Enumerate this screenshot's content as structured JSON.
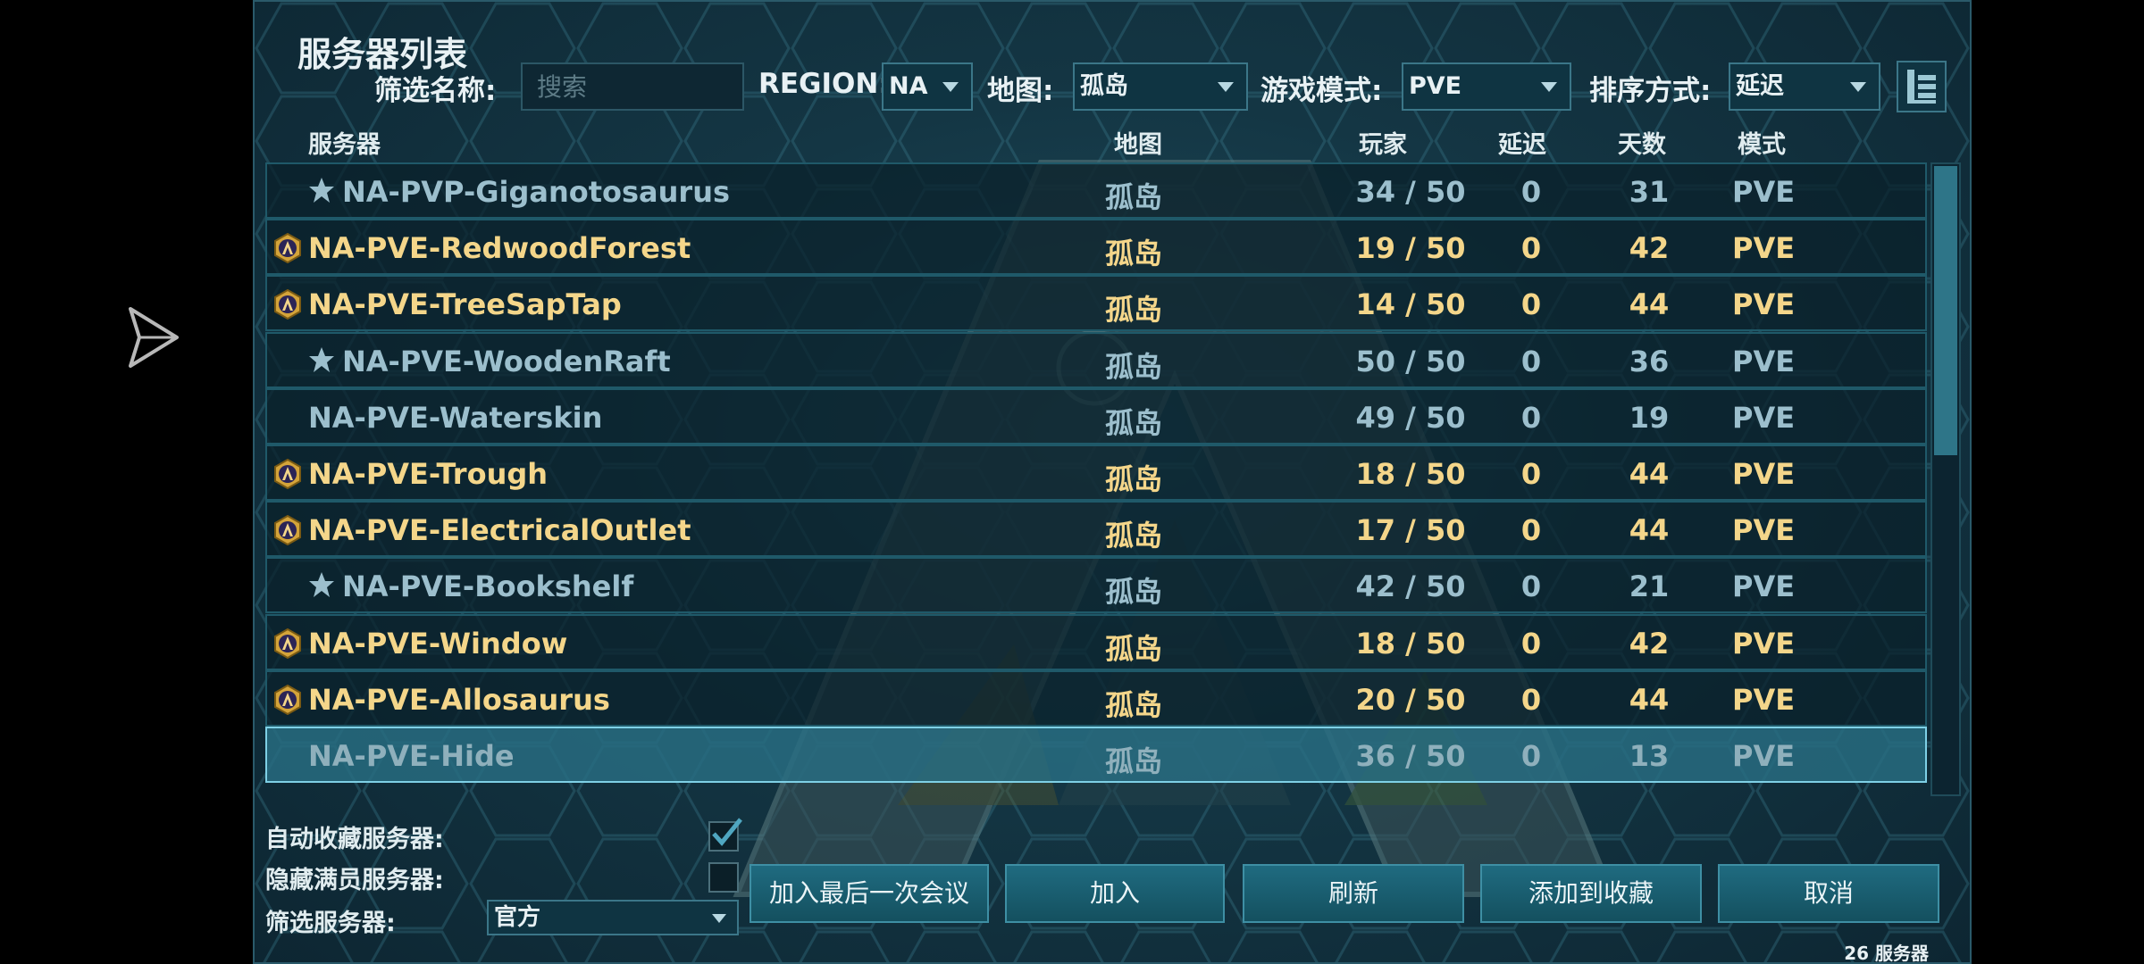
{
  "title": "服务器列表",
  "filters": {
    "name_label": "筛选名称:",
    "search_placeholder": "搜索",
    "region_label": "REGION:",
    "region_value": "NA",
    "map_label": "地图:",
    "map_value": "孤岛",
    "mode_label": "游戏模式:",
    "mode_value": "PVE",
    "sort_label": "排序方式:",
    "sort_value": "延迟"
  },
  "columns": {
    "server": "服务器",
    "map": "地图",
    "players": "玩家",
    "ping": "延迟",
    "days": "天数",
    "mode": "模式"
  },
  "servers": [
    {
      "name": "NA-PVP-Giganotosaurus",
      "map": "孤岛",
      "players": "34 / 50",
      "ping": "0",
      "days": "31",
      "mode": "PVE",
      "style": "favorite",
      "selected": false
    },
    {
      "name": "NA-PVE-RedwoodForest",
      "map": "孤岛",
      "players": "19 / 50",
      "ping": "0",
      "days": "42",
      "mode": "PVE",
      "style": "official",
      "selected": false
    },
    {
      "name": "NA-PVE-TreeSapTap",
      "map": "孤岛",
      "players": "14 / 50",
      "ping": "0",
      "days": "44",
      "mode": "PVE",
      "style": "official",
      "selected": false
    },
    {
      "name": "NA-PVE-WoodenRaft",
      "map": "孤岛",
      "players": "50 / 50",
      "ping": "0",
      "days": "36",
      "mode": "PVE",
      "style": "favorite",
      "selected": false
    },
    {
      "name": "NA-PVE-Waterskin",
      "map": "孤岛",
      "players": "49 / 50",
      "ping": "0",
      "days": "19",
      "mode": "PVE",
      "style": "plain",
      "selected": false
    },
    {
      "name": "NA-PVE-Trough",
      "map": "孤岛",
      "players": "18 / 50",
      "ping": "0",
      "days": "44",
      "mode": "PVE",
      "style": "official",
      "selected": false
    },
    {
      "name": "NA-PVE-ElectricalOutlet",
      "map": "孤岛",
      "players": "17 / 50",
      "ping": "0",
      "days": "44",
      "mode": "PVE",
      "style": "official",
      "selected": false
    },
    {
      "name": "NA-PVE-Bookshelf",
      "map": "孤岛",
      "players": "42 / 50",
      "ping": "0",
      "days": "21",
      "mode": "PVE",
      "style": "favorite",
      "selected": false
    },
    {
      "name": "NA-PVE-Window",
      "map": "孤岛",
      "players": "18 / 50",
      "ping": "0",
      "days": "42",
      "mode": "PVE",
      "style": "official",
      "selected": false
    },
    {
      "name": "NA-PVE-Allosaurus",
      "map": "孤岛",
      "players": "20 / 50",
      "ping": "0",
      "days": "44",
      "mode": "PVE",
      "style": "official",
      "selected": false
    },
    {
      "name": "NA-PVE-Hide",
      "map": "孤岛",
      "players": "36 / 50",
      "ping": "0",
      "days": "13",
      "mode": "PVE",
      "style": "plain",
      "selected": true
    }
  ],
  "options": {
    "auto_favorite_label": "自动收藏服务器:",
    "auto_favorite_checked": true,
    "hide_full_label": "隐藏满员服务器:",
    "hide_full_checked": false,
    "filter_servers_label": "筛选服务器:",
    "filter_servers_value": "官方"
  },
  "buttons": {
    "join_last": "加入最后一次会议",
    "join": "加入",
    "refresh": "刷新",
    "add_favorite": "添加到收藏",
    "cancel": "取消"
  },
  "server_count": "26 服务器",
  "colors": {
    "accent": "#2e7588",
    "official": "#f4d68a",
    "normal": "#9cbfcd"
  },
  "icons": {
    "favorite": "star-icon",
    "official": "official-badge-icon",
    "cursor": "send-arrow-icon",
    "view": "list-view-icon"
  }
}
